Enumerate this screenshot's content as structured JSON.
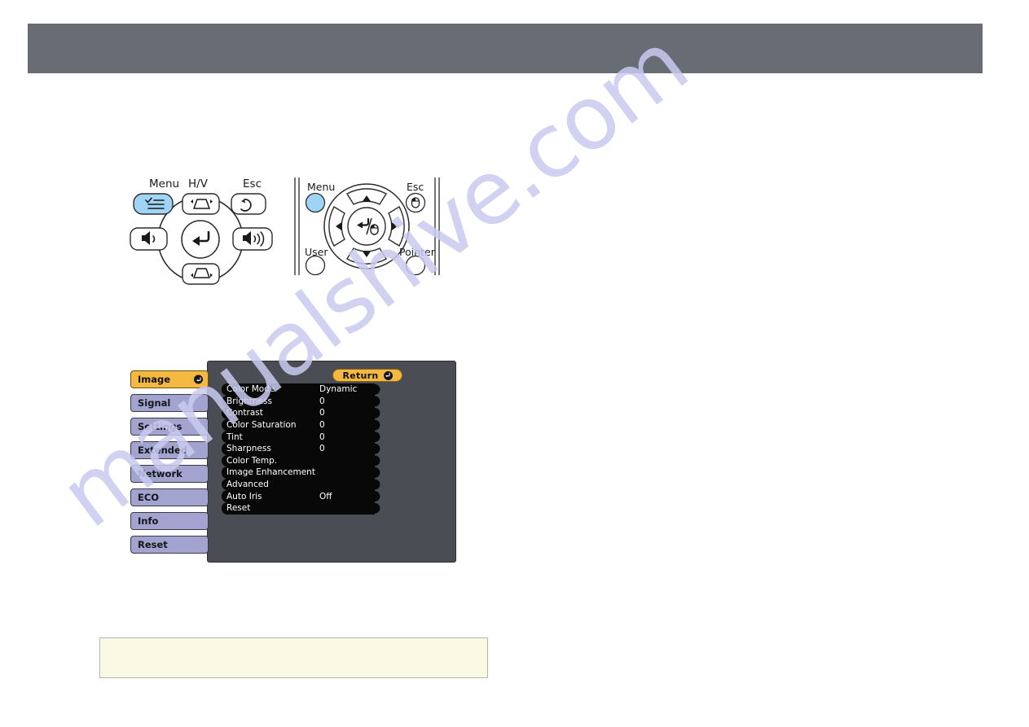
{
  "page": {
    "watermark": "manualshive.com"
  },
  "header": {
    "title": ""
  },
  "figure_control_panel": {
    "caption": "",
    "labels": {
      "menu": "Menu",
      "hv": "H/V",
      "esc": "Esc"
    },
    "buttons": [
      {
        "name": "menu-button",
        "label": "Menu",
        "icon": "menu-list-icon",
        "highlighted": true
      },
      {
        "name": "keystone-up-button",
        "label": "H/V",
        "icon": "keystone-icon",
        "highlighted": false
      },
      {
        "name": "esc-button",
        "label": "Esc",
        "icon": "back-arrow-icon",
        "highlighted": false
      },
      {
        "name": "volume-down-button",
        "label": "",
        "icon": "speaker-low-icon",
        "highlighted": false
      },
      {
        "name": "enter-button",
        "label": "",
        "icon": "enter-arrow-icon",
        "highlighted": false
      },
      {
        "name": "volume-up-button",
        "label": "",
        "icon": "speaker-high-icon",
        "highlighted": false
      },
      {
        "name": "keystone-down-button",
        "label": "",
        "icon": "keystone-down-icon",
        "highlighted": false
      }
    ]
  },
  "figure_remote": {
    "labels": {
      "menu": "Menu",
      "esc": "Esc",
      "user": "User",
      "pointer": "Pointer"
    },
    "buttons": [
      {
        "name": "remote-menu-button",
        "label": "Menu",
        "highlighted": true
      },
      {
        "name": "remote-esc-button",
        "label": "Esc",
        "icon": "mouse-icon",
        "highlighted": false
      },
      {
        "name": "remote-user-button",
        "label": "User",
        "highlighted": false
      },
      {
        "name": "remote-pointer-button",
        "label": "Pointer",
        "highlighted": false
      },
      {
        "name": "remote-up-button",
        "label": "",
        "icon": "triangle-up-icon",
        "highlighted": false
      },
      {
        "name": "remote-down-button",
        "label": "",
        "icon": "triangle-down-icon",
        "highlighted": false
      },
      {
        "name": "remote-left-button",
        "label": "",
        "icon": "triangle-left-icon",
        "highlighted": false
      },
      {
        "name": "remote-right-button",
        "label": "",
        "icon": "triangle-right-icon",
        "highlighted": false
      },
      {
        "name": "remote-enter-button",
        "label": "",
        "icon": "enter-mouse-icon",
        "highlighted": false
      }
    ]
  },
  "osd": {
    "return_label": "Return",
    "return_icon": "enter-icon",
    "sidebar": [
      {
        "label": "Image",
        "active": true,
        "icon": "enter-icon"
      },
      {
        "label": "Signal",
        "active": false,
        "icon": ""
      },
      {
        "label": "Settings",
        "active": false,
        "icon": ""
      },
      {
        "label": "Extended",
        "active": false,
        "icon": ""
      },
      {
        "label": "Network",
        "active": false,
        "icon": ""
      },
      {
        "label": "ECO",
        "active": false,
        "icon": ""
      },
      {
        "label": "Info",
        "active": false,
        "icon": ""
      },
      {
        "label": "Reset",
        "active": false,
        "icon": ""
      }
    ],
    "rows": [
      {
        "label": "Color Mode",
        "value": "Dynamic"
      },
      {
        "label": "Brightness",
        "value": "0"
      },
      {
        "label": "Contrast",
        "value": "0"
      },
      {
        "label": "Color Saturation",
        "value": "0"
      },
      {
        "label": "Tint",
        "value": "0"
      },
      {
        "label": "Sharpness",
        "value": "0"
      },
      {
        "label": "Color Temp.",
        "value": ""
      },
      {
        "label": "Image Enhancement",
        "value": ""
      },
      {
        "label": "Advanced",
        "value": ""
      },
      {
        "label": "Auto Iris",
        "value": "Off"
      },
      {
        "label": "Reset",
        "value": ""
      }
    ]
  },
  "note": {
    "text": ""
  },
  "colors": {
    "header_band": "#686c75",
    "tab_active": "#f5b942",
    "tab_inactive": "#a3a3cf",
    "osd_panel": "#4b4d55",
    "osd_list": "#080808",
    "note_bg": "#fbf8e4",
    "note_border": "#b4b4b4",
    "highlight_blue": "#9fd4f5",
    "watermark": "#c9cbf0"
  }
}
